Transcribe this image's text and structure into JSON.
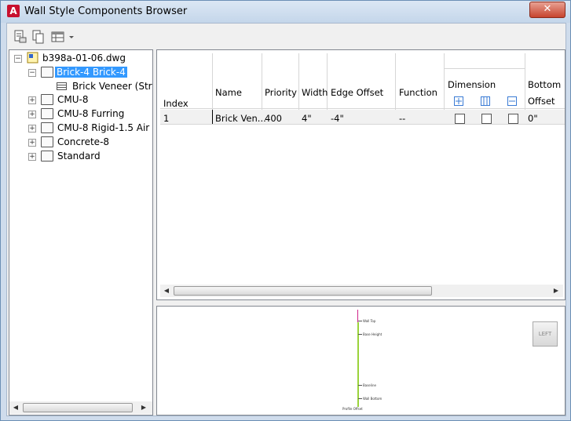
{
  "window": {
    "title": "Wall Style Components Browser",
    "close_glyph": "✕"
  },
  "toolbar": {
    "icons": [
      "document-list-icon",
      "copy-icon",
      "table-view-icon",
      "dropdown-arrow-icon"
    ]
  },
  "tree": {
    "root": "b398a-01-06.dwg",
    "items": [
      {
        "label": "Brick-4 Brick-4",
        "selected": true,
        "expanded": true,
        "children": [
          "Brick Veneer (Struc"
        ]
      },
      {
        "label": "CMU-8"
      },
      {
        "label": "CMU-8 Furring"
      },
      {
        "label": "CMU-8 Rigid-1.5 Air"
      },
      {
        "label": "Concrete-8"
      },
      {
        "label": "Standard"
      }
    ]
  },
  "grid": {
    "headers": {
      "index": "Index",
      "name": "Name",
      "priority": "Priority",
      "width": "Width",
      "edge_offset": "Edge Offset",
      "function": "Function",
      "dimension": "Dimension",
      "bottom_elev": "Bottom Ele",
      "offset": "Offset"
    },
    "rows": [
      {
        "index": "1",
        "name": "Brick Ven...",
        "priority": "400",
        "width": "4\"",
        "edge_offset": "-4\"",
        "function": "--",
        "dim1": false,
        "dim2": false,
        "dim3": false,
        "offset": "0\""
      }
    ]
  },
  "preview": {
    "button_label": "LEFT",
    "labels": [
      "Wall Top",
      "Base Height",
      "Baseline",
      "Wall Bottom",
      "Profile Offset"
    ]
  },
  "colors": {
    "selection": "#3399ff",
    "preview_line": "#9ad33a",
    "preview_top": "#d0248a"
  }
}
